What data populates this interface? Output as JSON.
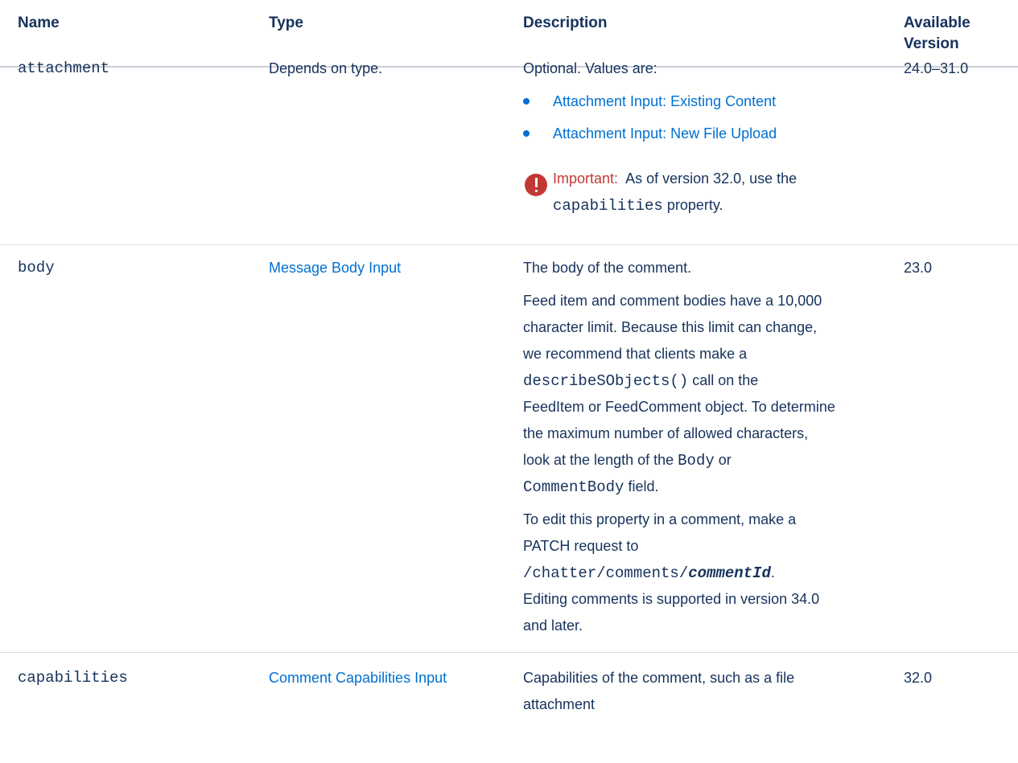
{
  "header": {
    "name": "Name",
    "type": "Type",
    "description": "Description",
    "version_line1": "Available",
    "version_line2": "Version"
  },
  "rows": [
    {
      "name": "attachment",
      "type": "Depends on type.",
      "desc_intro": "Optional. Values are:",
      "links": [
        "Attachment Input: Existing Content",
        "Attachment Input: New File Upload"
      ],
      "important_label": "Important:",
      "important_text_1": "As of version 32.0, use the",
      "important_code": "capabilities",
      "important_text_2": "property.",
      "version": "24.0–31.0"
    },
    {
      "name": "body",
      "type_link": "Message Body Input",
      "desc_1": "The body of the comment.",
      "desc_2_lines": [
        "Feed item and comment bodies have a 10,000",
        "character limit. Because this limit can change,",
        "we recommend that clients make a"
      ],
      "desc_2_code1": "describeSObjects()",
      "desc_2_after_code1": "call on the",
      "desc_2_lines_b": [
        "FeedItem or FeedComment object. To determine",
        "the maximum number of allowed characters,"
      ],
      "desc_2_pre_code2": "look at the length of the",
      "desc_2_code2": "Body",
      "desc_2_after_code2": "or",
      "desc_2_code3": "CommentBody",
      "desc_2_after_code3": "field.",
      "desc_3_lines": [
        "To edit this property in a comment, make a",
        "PATCH request to"
      ],
      "desc_3_code": "/chatter/comments/",
      "desc_3_code_param": "commentId",
      "desc_3_after": ".",
      "desc_3_tail": [
        "Editing comments is supported in version 34.0",
        "and later."
      ],
      "version": "23.0"
    },
    {
      "name": "capabilities",
      "type_link": "Comment Capabilities Input",
      "desc_lines": [
        "Capabilities of the comment, such as a file",
        "attachment"
      ],
      "version": "32.0"
    }
  ]
}
